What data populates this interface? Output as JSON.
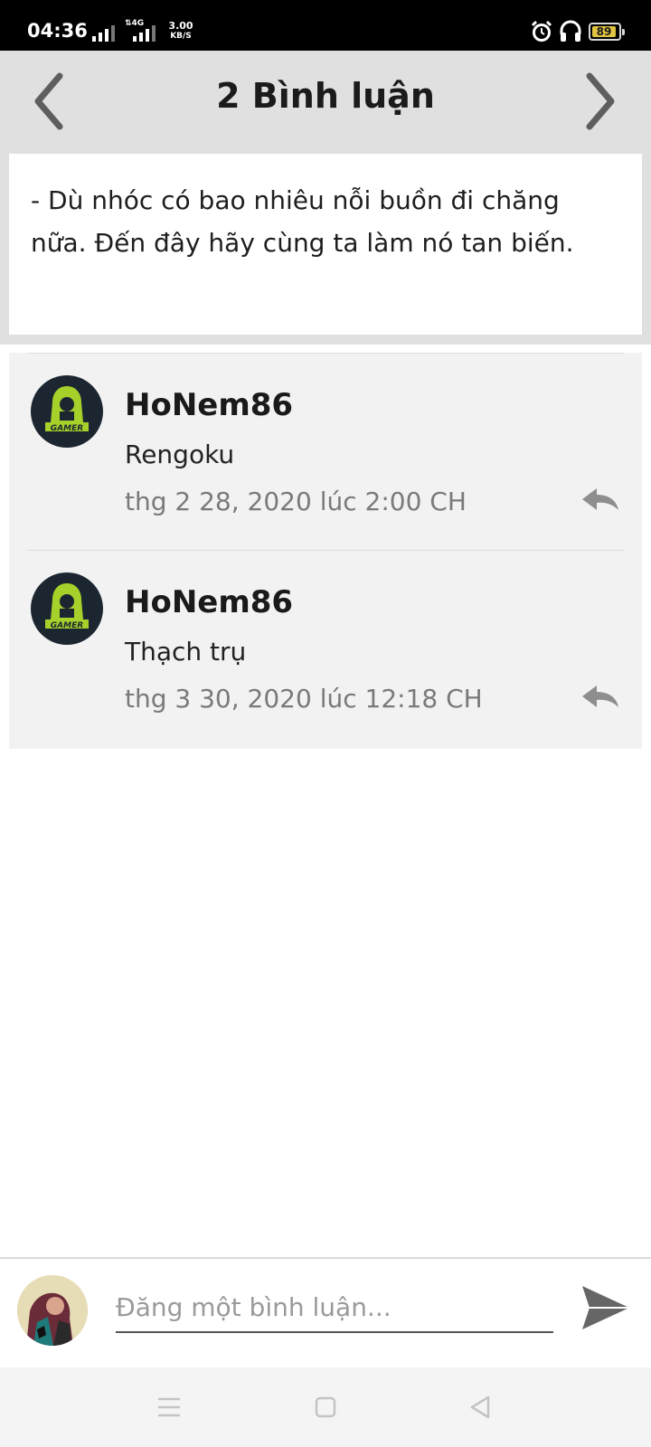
{
  "status_bar": {
    "time": "04:36",
    "network": "4G",
    "speed_value": "3.00",
    "speed_unit": "KB/S",
    "battery": "89",
    "battery_color": "#e1c542"
  },
  "header": {
    "title": "2 Bình luận",
    "prev_icon": "chevron-left-icon",
    "next_icon": "chevron-right-icon"
  },
  "post": {
    "text_line1": "- Dù nhóc có bao nhiêu nỗi buồn đi chăng",
    "text_line2": "nữa. Đến đây hãy cùng ta làm nó tan biến."
  },
  "comments": [
    {
      "author": "HoNem86",
      "text": "Rengoku",
      "time": "thg 2 28, 2020 lúc 2:00 CH",
      "avatar_text": "GAMER"
    },
    {
      "author": "HoNem86",
      "text": "Thạch trụ",
      "time": "thg 3 30, 2020 lúc 12:18 CH",
      "avatar_text": "GAMER"
    }
  ],
  "composer": {
    "placeholder": "Đăng một bình luận..."
  },
  "colors": {
    "header_bg": "#e0e0e0",
    "comment_bg": "#f2f2f2",
    "avatar_accent": "#a6d12b"
  }
}
